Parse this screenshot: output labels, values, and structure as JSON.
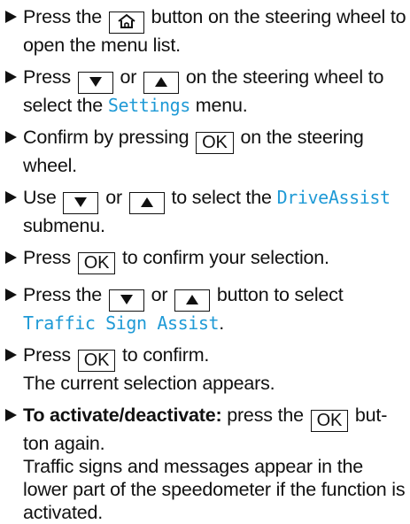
{
  "colors": {
    "menu_text": "#1f9ad6",
    "text": "#111111",
    "background": "#ffffff"
  },
  "icons": {
    "bullet": "triangle-right-icon",
    "home": "home-icon",
    "down": "down-arrow-icon",
    "up": "up-arrow-icon"
  },
  "steps": [
    {
      "t1": "Press the",
      "t2": "button on the steering wheel to open the menu list."
    },
    {
      "t1": "Press",
      "t2": "or",
      "t3": "on the steering wheel to select the",
      "menu": "Settings",
      "t4": "menu."
    },
    {
      "t1": "Confirm by pressing",
      "key": "OK",
      "t2": "on the steering wheel."
    },
    {
      "t1": "Use",
      "t2": "or",
      "t3": "to select the",
      "menu": "DriveAssist",
      "t4": "submenu."
    },
    {
      "t1": "Press",
      "key": "OK",
      "t2": "to confirm your selection."
    },
    {
      "t1": "Press the",
      "t2": "or",
      "t3": "button to select",
      "menu": "Traffic Sign Assist",
      "t4": "."
    },
    {
      "t1": "Press",
      "key": "OK",
      "t2": "to confirm.",
      "t3": "The current selection appears."
    },
    {
      "bold": "To activate/deactivate:",
      "t1": "press the",
      "key": "OK",
      "t2": "but-ton again.",
      "t3": "Traffic signs and messages appear in the lower part of the speedometer if the function is activated."
    }
  ]
}
